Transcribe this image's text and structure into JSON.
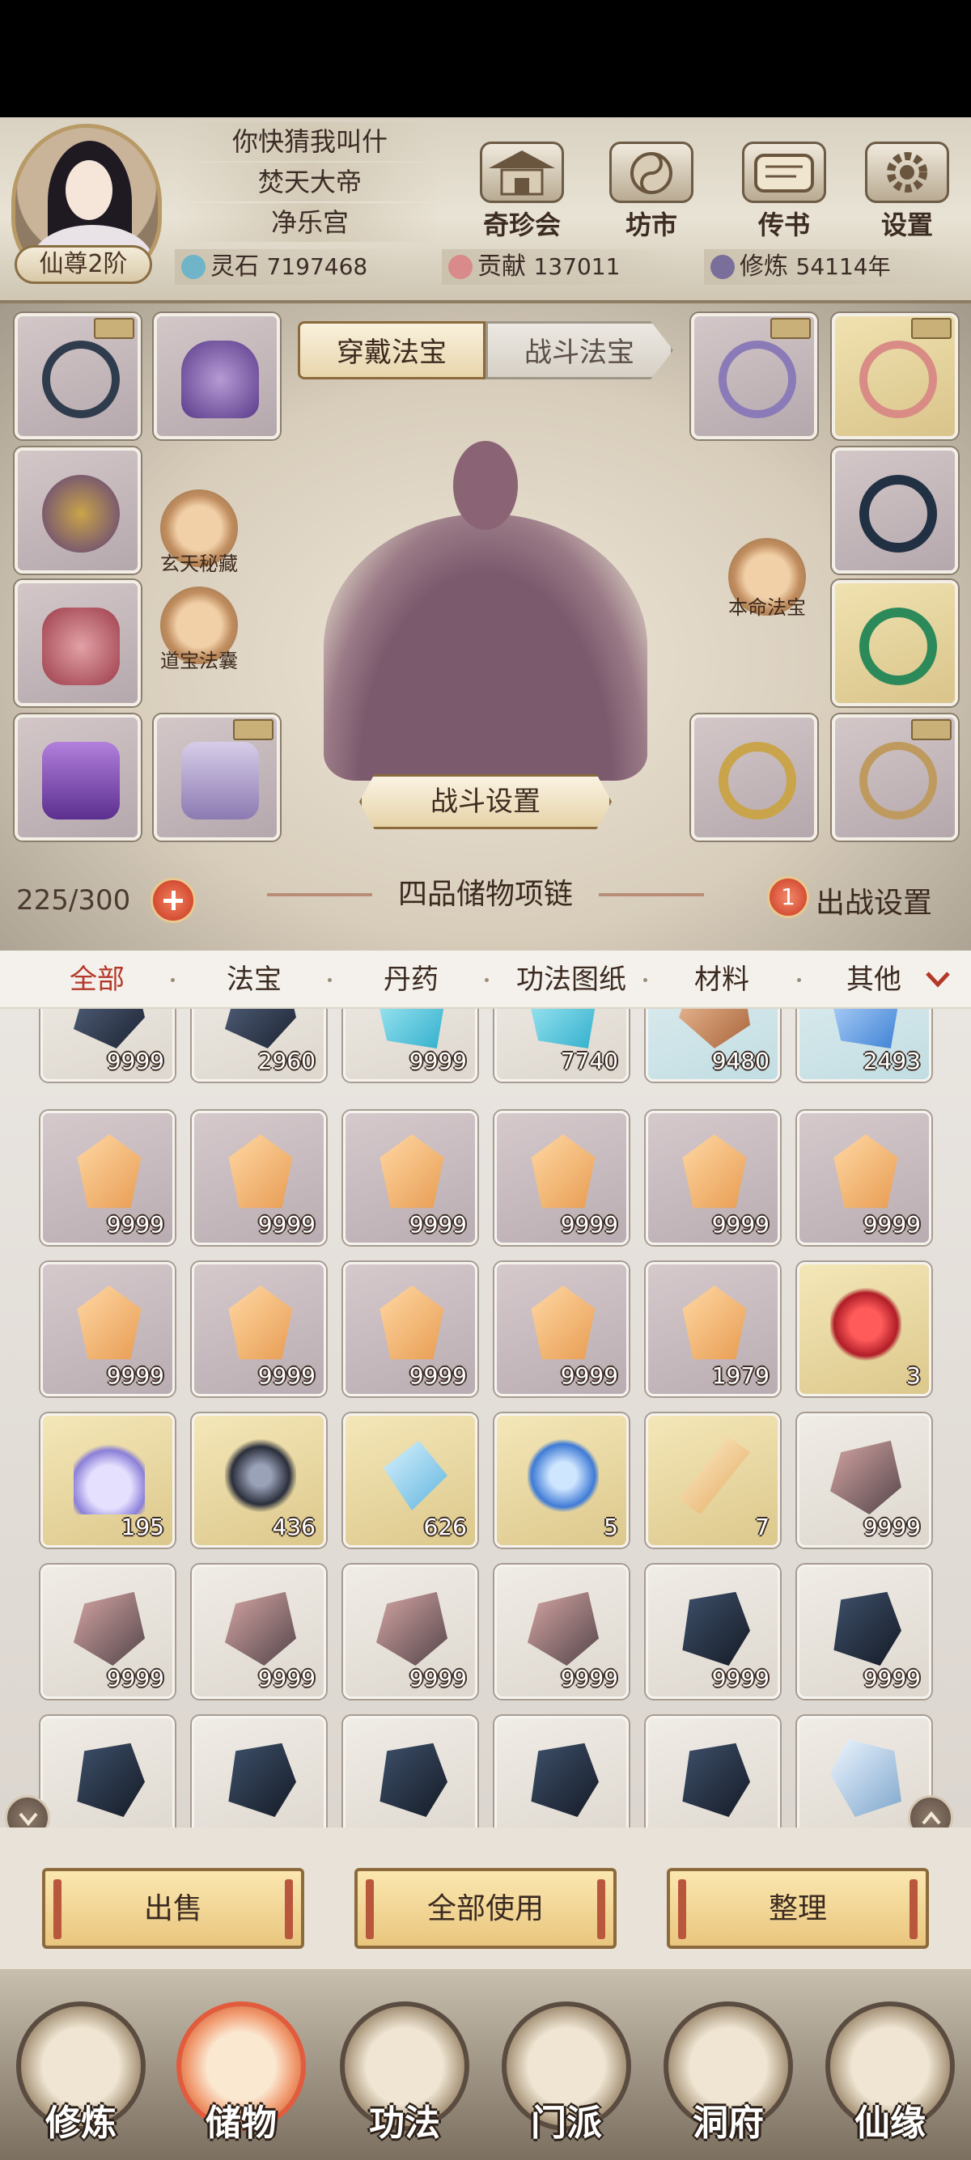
{
  "header": {
    "player_lines": [
      "你快猜我叫什",
      "焚天大帝",
      "净乐宫"
    ],
    "rank": "仙尊2阶",
    "buttons": [
      {
        "label": "奇珍会",
        "icon": "pavilion-icon"
      },
      {
        "label": "坊市",
        "icon": "market-icon"
      },
      {
        "label": "传书",
        "icon": "scroll-letter-icon"
      },
      {
        "label": "设置",
        "icon": "gear-icon"
      }
    ],
    "resources": [
      {
        "label": "灵石",
        "value": "7197468",
        "color": "#6fb4c8",
        "icon": "spirit-stone-icon"
      },
      {
        "label": "贡献",
        "value": "137011",
        "color": "#d98a8a",
        "icon": "contribution-icon"
      },
      {
        "label": "修炼",
        "value": "54114年",
        "color": "#7a6f9a",
        "icon": "cultivation-icon"
      }
    ]
  },
  "equip": {
    "tabs": {
      "active": "穿戴法宝",
      "inactive": "战斗法宝"
    },
    "left_shortcuts": [
      "玄天秘藏",
      "道宝法囊"
    ],
    "right_shortcut": "本命法宝",
    "battle_settings": "战斗设置",
    "capacity": "225/300",
    "bag_title": "四品储物项链",
    "deploy_count": "1",
    "deploy_label": "出战设置"
  },
  "categories": [
    "全部",
    "法宝",
    "丹药",
    "功法图纸",
    "材料",
    "其他"
  ],
  "grid": {
    "rows": [
      [
        {
          "count": "9999",
          "kind": "dark-ore",
          "bg": "plain"
        },
        {
          "count": "2960",
          "kind": "dark-ore",
          "bg": "plain"
        },
        {
          "count": "9999",
          "kind": "cyan-crystal",
          "bg": "plain"
        },
        {
          "count": "7740",
          "kind": "cyan-crystal",
          "bg": "plain"
        },
        {
          "count": "9480",
          "kind": "amber-rock",
          "bg": "cyan"
        },
        {
          "count": "2493",
          "kind": "blue-crystal",
          "bg": "cyan"
        }
      ],
      [
        {
          "count": "9999",
          "kind": "orange-gem",
          "bg": "purple"
        },
        {
          "count": "9999",
          "kind": "orange-gem",
          "bg": "purple"
        },
        {
          "count": "9999",
          "kind": "orange-gem",
          "bg": "purple"
        },
        {
          "count": "9999",
          "kind": "orange-gem",
          "bg": "purple"
        },
        {
          "count": "9999",
          "kind": "orange-gem",
          "bg": "purple"
        },
        {
          "count": "9999",
          "kind": "orange-gem",
          "bg": "purple"
        }
      ],
      [
        {
          "count": "9999",
          "kind": "orange-gem",
          "bg": "purple"
        },
        {
          "count": "9999",
          "kind": "orange-gem",
          "bg": "purple"
        },
        {
          "count": "9999",
          "kind": "orange-gem",
          "bg": "purple"
        },
        {
          "count": "9999",
          "kind": "orange-gem",
          "bg": "purple"
        },
        {
          "count": "1979",
          "kind": "orange-gem",
          "bg": "purple"
        },
        {
          "count": "3",
          "kind": "red-flower",
          "bg": "gold"
        }
      ],
      [
        {
          "count": "195",
          "kind": "spirit-vase",
          "bg": "gold"
        },
        {
          "count": "436",
          "kind": "black-ore",
          "bg": "gold"
        },
        {
          "count": "626",
          "kind": "ice-slab",
          "bg": "gold"
        },
        {
          "count": "5",
          "kind": "water-spirit",
          "bg": "gold"
        },
        {
          "count": "7",
          "kind": "amber-crystal",
          "bg": "gold"
        },
        {
          "count": "9999",
          "kind": "patterned-stone",
          "bg": "plain"
        }
      ],
      [
        {
          "count": "9999",
          "kind": "patterned-stone",
          "bg": "plain"
        },
        {
          "count": "9999",
          "kind": "patterned-stone",
          "bg": "plain"
        },
        {
          "count": "9999",
          "kind": "patterned-stone",
          "bg": "plain"
        },
        {
          "count": "9999",
          "kind": "patterned-stone",
          "bg": "plain"
        },
        {
          "count": "9999",
          "kind": "rune-ore",
          "bg": "plain"
        },
        {
          "count": "9999",
          "kind": "rune-ore",
          "bg": "plain"
        }
      ],
      [
        {
          "count": "",
          "kind": "rune-ore",
          "bg": "plain"
        },
        {
          "count": "",
          "kind": "rune-ore",
          "bg": "plain"
        },
        {
          "count": "",
          "kind": "rune-ore",
          "bg": "plain"
        },
        {
          "count": "",
          "kind": "rune-ore",
          "bg": "plain"
        },
        {
          "count": "",
          "kind": "rune-ore",
          "bg": "plain"
        },
        {
          "count": "",
          "kind": "ice-crystal",
          "bg": "plain"
        }
      ]
    ]
  },
  "actions": [
    "出售",
    "全部使用",
    "整理"
  ],
  "nav": [
    {
      "label": "修炼",
      "icon": "cultivate-icon"
    },
    {
      "label": "储物",
      "icon": "storage-bag-icon"
    },
    {
      "label": "功法",
      "icon": "technique-book-icon"
    },
    {
      "label": "门派",
      "icon": "sect-gate-icon"
    },
    {
      "label": "洞府",
      "icon": "cave-mansion-icon"
    },
    {
      "label": "仙缘",
      "icon": "immortal-fate-icon"
    }
  ],
  "colors": {
    "accent": "#b4382a",
    "gold": "#e9c67e",
    "purple_cell": "#c5b9be"
  }
}
